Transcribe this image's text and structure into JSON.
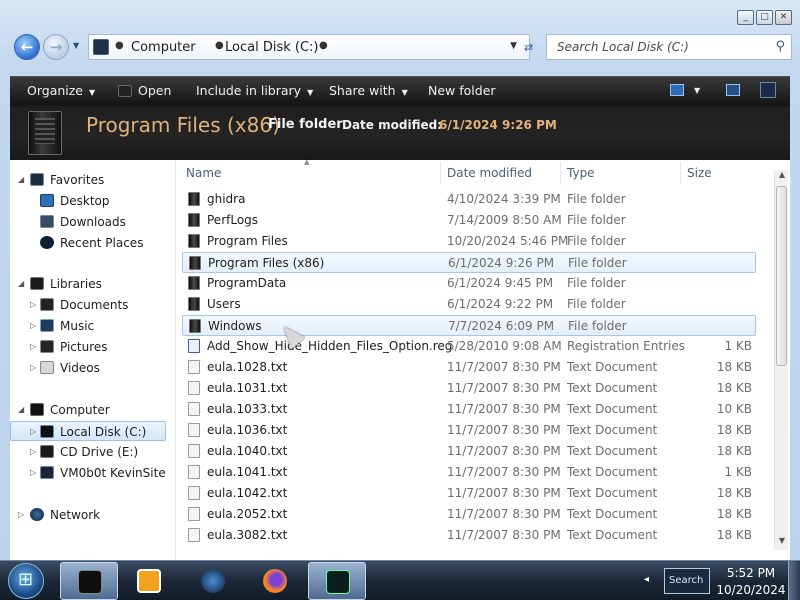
{
  "window": {
    "caption_buttons": [
      "minimize",
      "maximize",
      "close"
    ]
  },
  "address": {
    "crumbs": [
      "Computer",
      "Local Disk (C:)"
    ],
    "search_placeholder": "Search Local Disk (C:)"
  },
  "toolbar": {
    "organize": "Organize",
    "open": "Open",
    "include": "Include in library",
    "share": "Share with",
    "new_folder": "New folder"
  },
  "details": {
    "name": "Program Files (x86)",
    "type": "File folder",
    "modified_label": "Date modified:",
    "modified_value": "6/1/2024 9:26 PM"
  },
  "nav": {
    "favorites": {
      "label": "Favorites",
      "items": [
        "Desktop",
        "Downloads",
        "Recent Places"
      ]
    },
    "libraries": {
      "label": "Libraries",
      "items": [
        "Documents",
        "Music",
        "Pictures",
        "Videos"
      ]
    },
    "computer": {
      "label": "Computer",
      "items": [
        "Local Disk (C:)",
        "CD Drive (E:)",
        "VM0b0t KevinSite"
      ]
    },
    "network": {
      "label": "Network"
    }
  },
  "columns": {
    "name": "Name",
    "date": "Date modified",
    "type": "Type",
    "size": "Size"
  },
  "files": [
    {
      "name": "ghidra",
      "date": "4/10/2024 3:39 PM",
      "type": "File folder",
      "size": "",
      "icon": "folder"
    },
    {
      "name": "PerfLogs",
      "date": "7/14/2009 8:50 AM",
      "type": "File folder",
      "size": "",
      "icon": "folder"
    },
    {
      "name": "Program Files",
      "date": "10/20/2024 5:46 PM",
      "type": "File folder",
      "size": "",
      "icon": "folder"
    },
    {
      "name": "Program Files (x86)",
      "date": "6/1/2024 9:26 PM",
      "type": "File folder",
      "size": "",
      "icon": "folder",
      "selected": true
    },
    {
      "name": "ProgramData",
      "date": "6/1/2024 9:45 PM",
      "type": "File folder",
      "size": "",
      "icon": "folder"
    },
    {
      "name": "Users",
      "date": "6/1/2024 9:22 PM",
      "type": "File folder",
      "size": "",
      "icon": "folder"
    },
    {
      "name": "Windows",
      "date": "7/7/2024 6:09 PM",
      "type": "File folder",
      "size": "",
      "icon": "folder",
      "hover": true
    },
    {
      "name": "Add_Show_Hide_Hidden_Files_Option.reg",
      "date": "5/28/2010 9:08 AM",
      "type": "Registration Entries",
      "size": "1 KB",
      "icon": "reg"
    },
    {
      "name": "eula.1028.txt",
      "date": "11/7/2007 8:30 PM",
      "type": "Text Document",
      "size": "18 KB",
      "icon": "txt"
    },
    {
      "name": "eula.1031.txt",
      "date": "11/7/2007 8:30 PM",
      "type": "Text Document",
      "size": "18 KB",
      "icon": "txt"
    },
    {
      "name": "eula.1033.txt",
      "date": "11/7/2007 8:30 PM",
      "type": "Text Document",
      "size": "10 KB",
      "icon": "txt"
    },
    {
      "name": "eula.1036.txt",
      "date": "11/7/2007 8:30 PM",
      "type": "Text Document",
      "size": "18 KB",
      "icon": "txt"
    },
    {
      "name": "eula.1040.txt",
      "date": "11/7/2007 8:30 PM",
      "type": "Text Document",
      "size": "18 KB",
      "icon": "txt"
    },
    {
      "name": "eula.1041.txt",
      "date": "11/7/2007 8:30 PM",
      "type": "Text Document",
      "size": "1 KB",
      "icon": "txt"
    },
    {
      "name": "eula.1042.txt",
      "date": "11/7/2007 8:30 PM",
      "type": "Text Document",
      "size": "18 KB",
      "icon": "txt"
    },
    {
      "name": "eula.2052.txt",
      "date": "11/7/2007 8:30 PM",
      "type": "Text Document",
      "size": "18 KB",
      "icon": "txt"
    },
    {
      "name": "eula.3082.txt",
      "date": "11/7/2007 8:30 PM",
      "type": "Text Document",
      "size": "18 KB",
      "icon": "txt"
    }
  ],
  "taskbar": {
    "apps": [
      "explorer-icon",
      "media-player-icon",
      "globe-icon",
      "firefox-icon",
      "terminal-monitor-icon"
    ],
    "tray_search": "Search",
    "time": "5:52 PM",
    "date": "10/20/2024"
  },
  "colors": {
    "accent_blue": "#2b6fd0",
    "details_name": "#e3b17a",
    "selection_border": "#a6c6ea"
  }
}
